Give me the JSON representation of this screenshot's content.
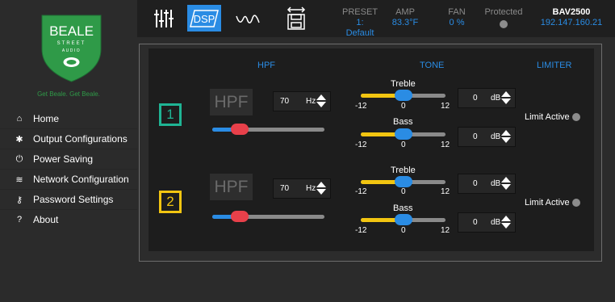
{
  "brand": {
    "name": "BEALE",
    "sub1": "STREET",
    "sub2": "AUDIO",
    "tagline": "Get Beale. Get Beale."
  },
  "nav": [
    {
      "icon": "home-icon",
      "glyph": "⌂",
      "label": "Home"
    },
    {
      "icon": "gear-icon",
      "glyph": "✱",
      "label": "Output Configurations"
    },
    {
      "icon": "power-icon",
      "glyph": "⏻",
      "label": "Power Saving"
    },
    {
      "icon": "wifi-icon",
      "glyph": "≋",
      "label": "Network Configuration"
    },
    {
      "icon": "key-icon",
      "glyph": "⚷",
      "label": "Password Settings"
    },
    {
      "icon": "question-icon",
      "glyph": "?",
      "label": "About"
    }
  ],
  "toolbar": {
    "dsp_label": "DSP"
  },
  "status": {
    "preset_label": "PRESET",
    "preset_value": "1: Default",
    "amp_label": "AMP",
    "amp_value": "83.3°F",
    "fan_label": "FAN",
    "fan_value": "0 %",
    "protected_label": "Protected",
    "device_name": "BAV2500",
    "device_ip": "192.147.160.21"
  },
  "dsp": {
    "headers": {
      "hpf": "HPF",
      "tone": "TONE",
      "limiter": "LIMITER"
    },
    "channels": [
      {
        "number": "1",
        "color": "#1fb494",
        "hpf": {
          "button": "HPF",
          "value": "70",
          "unit": "Hz",
          "slider": 0.2
        },
        "treble": {
          "label": "Treble",
          "value": "0",
          "unit": "dB",
          "min": "-12",
          "mid": "0",
          "max": "12",
          "level": 0.5
        },
        "bass": {
          "label": "Bass",
          "value": "0",
          "unit": "dB",
          "min": "-12",
          "mid": "0",
          "max": "12",
          "level": 0.5
        },
        "limit": "Limit Active"
      },
      {
        "number": "2",
        "color": "#f2c511",
        "hpf": {
          "button": "HPF",
          "value": "70",
          "unit": "Hz",
          "slider": 0.2
        },
        "treble": {
          "label": "Treble",
          "value": "0",
          "unit": "dB",
          "min": "-12",
          "mid": "0",
          "max": "12",
          "level": 0.5
        },
        "bass": {
          "label": "Bass",
          "value": "0",
          "unit": "dB",
          "min": "-12",
          "mid": "0",
          "max": "12",
          "level": 0.5
        },
        "limit": "Limit Active"
      }
    ]
  },
  "colors": {
    "accent": "#2a8ce4",
    "hpf_thumb": "#e8404a",
    "tone_fill": "#f2c511",
    "brand_green": "#2f9a48"
  }
}
